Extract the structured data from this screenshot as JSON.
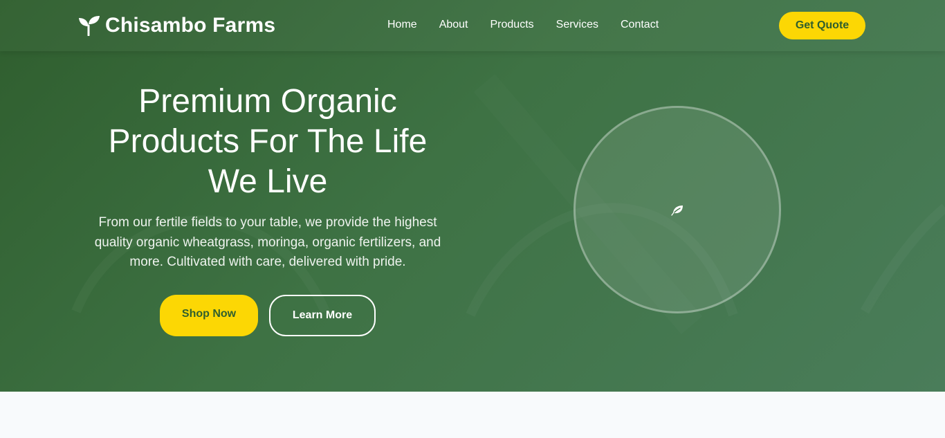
{
  "brand": {
    "name": "Chisambo Farms",
    "icon": "seedling-icon"
  },
  "nav": {
    "items": [
      {
        "label": "Home"
      },
      {
        "label": "About"
      },
      {
        "label": "Products"
      },
      {
        "label": "Services"
      },
      {
        "label": "Contact"
      }
    ],
    "cta_label": "Get Quote"
  },
  "hero": {
    "title_lines": [
      "Premium Organic",
      "Products For The Life",
      "We Live"
    ],
    "description": "From our fertile fields to your table, we provide the highest quality organic wheatgrass, moringa, organic fertilizers, and more. Cultivated with care, delivered with pride.",
    "primary_button": "Shop Now",
    "secondary_button": "Learn More",
    "visual_icon": "leaf-icon"
  },
  "colors": {
    "hero_green_dark": "#2f5e2e",
    "hero_green_light": "#4a7d5a",
    "accent_yellow": "#fcd704",
    "page_background": "#f8fafc"
  }
}
